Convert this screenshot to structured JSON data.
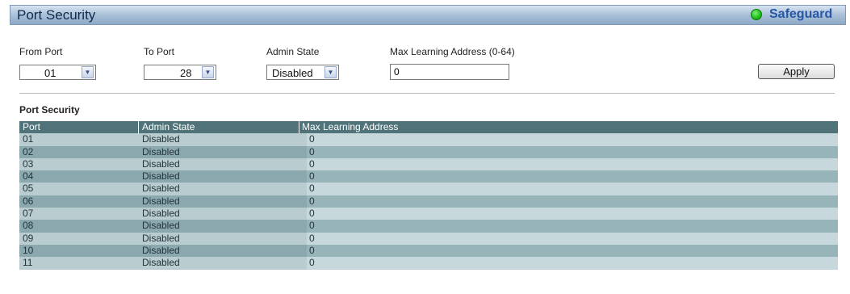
{
  "header": {
    "title": "Port Security",
    "safeguard_label": "Safeguard"
  },
  "form": {
    "from_port": {
      "label": "From Port",
      "value": "01"
    },
    "to_port": {
      "label": "To Port",
      "value": "28"
    },
    "admin_state": {
      "label": "Admin State",
      "value": "Disabled"
    },
    "max_learning": {
      "label": "Max Learning Address (0-64)",
      "value": "0"
    },
    "apply_label": "Apply"
  },
  "table": {
    "section_title": "Port Security",
    "columns": [
      "Port",
      "Admin State",
      "Max Learning Address"
    ],
    "rows": [
      {
        "port": "01",
        "admin_state": "Disabled",
        "max_learning": "0"
      },
      {
        "port": "02",
        "admin_state": "Disabled",
        "max_learning": "0"
      },
      {
        "port": "03",
        "admin_state": "Disabled",
        "max_learning": "0"
      },
      {
        "port": "04",
        "admin_state": "Disabled",
        "max_learning": "0"
      },
      {
        "port": "05",
        "admin_state": "Disabled",
        "max_learning": "0"
      },
      {
        "port": "06",
        "admin_state": "Disabled",
        "max_learning": "0"
      },
      {
        "port": "07",
        "admin_state": "Disabled",
        "max_learning": "0"
      },
      {
        "port": "08",
        "admin_state": "Disabled",
        "max_learning": "0"
      },
      {
        "port": "09",
        "admin_state": "Disabled",
        "max_learning": "0"
      },
      {
        "port": "10",
        "admin_state": "Disabled",
        "max_learning": "0"
      },
      {
        "port": "11",
        "admin_state": "Disabled",
        "max_learning": "0"
      }
    ]
  },
  "colors": {
    "header_row": "#4f7379",
    "row_light": "#b9cccf",
    "row_dark": "#8aa8ad",
    "safeguard_indicator": "#20c21c"
  }
}
